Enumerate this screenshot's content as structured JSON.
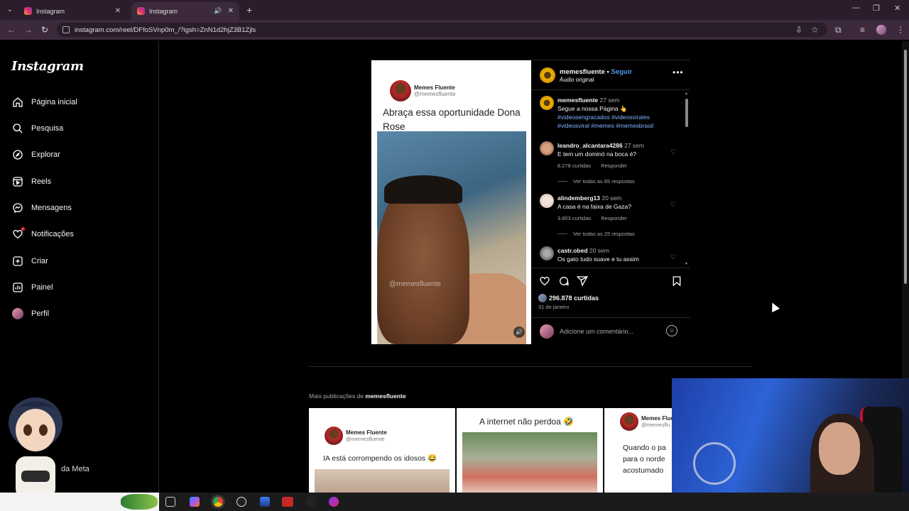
{
  "browser": {
    "tabs": [
      {
        "title": "Instagram"
      },
      {
        "title": "Instagram"
      }
    ],
    "url": "instagram.com/reel/DFfoSVnp0m_/?igsh=ZnN1d2hjZ3B1Zjls"
  },
  "sidebar": {
    "logo": "Instagram",
    "items": [
      {
        "label": "Página inicial"
      },
      {
        "label": "Pesquisa"
      },
      {
        "label": "Explorar"
      },
      {
        "label": "Reels"
      },
      {
        "label": "Mensagens"
      },
      {
        "label": "Notificações"
      },
      {
        "label": "Criar"
      },
      {
        "label": "Painel"
      },
      {
        "label": "Perfil"
      }
    ],
    "more_label": "da Meta"
  },
  "video": {
    "name": "Memes Fluente",
    "handle": "@memesfluente",
    "caption": "Abraça essa oportunidade Dona Rose",
    "watermark": "@memesfluente"
  },
  "post": {
    "author": "memesfluente",
    "follow": "Seguir",
    "audio": "Áudio original",
    "caption_comment": {
      "user": "memesfluente",
      "time": "27 sem",
      "text": "Segue a nossa Página 👆",
      "hashtags": "#videosengracados #videosvirales #videosviral #memes #memesbrasil"
    },
    "comments": [
      {
        "user": "leandro_alcantara4286",
        "time": "27 sem",
        "text": "E tem um dominó na boca é?",
        "likes": "8.278 curtidas",
        "reply": "Responder",
        "replies": "Ver todas as 85 respostas"
      },
      {
        "user": "alindemberg13",
        "time": "20 sem",
        "text": "A casa é na faixa de Gaza?",
        "likes": "3.803 curtidas",
        "reply": "Responder",
        "replies": "Ver todas as 25 respostas"
      },
      {
        "user": "castr.obed",
        "time": "20 sem",
        "text": "Os gato tudo suave e tu assim"
      }
    ],
    "likes": "296.878 curtidas",
    "date": "31 de janeiro",
    "comment_placeholder": "Adicione um comentário..."
  },
  "more": {
    "label": "Mais publicações de",
    "user": "memesfluente",
    "items": [
      {
        "name": "Memes Fluente",
        "handle": "@memesfluente",
        "caption": "IA está corrompendo os idosos 😂"
      },
      {
        "caption": "A internet não perdoa 🤣"
      },
      {
        "name": "Memes Flue",
        "handle": "@memesflu",
        "caption_1": "Quando o pa",
        "caption_2": "para o norde",
        "caption_3": "acostumado"
      }
    ]
  },
  "colors": {
    "accent": "#4d9bf5",
    "background": "#000000"
  }
}
